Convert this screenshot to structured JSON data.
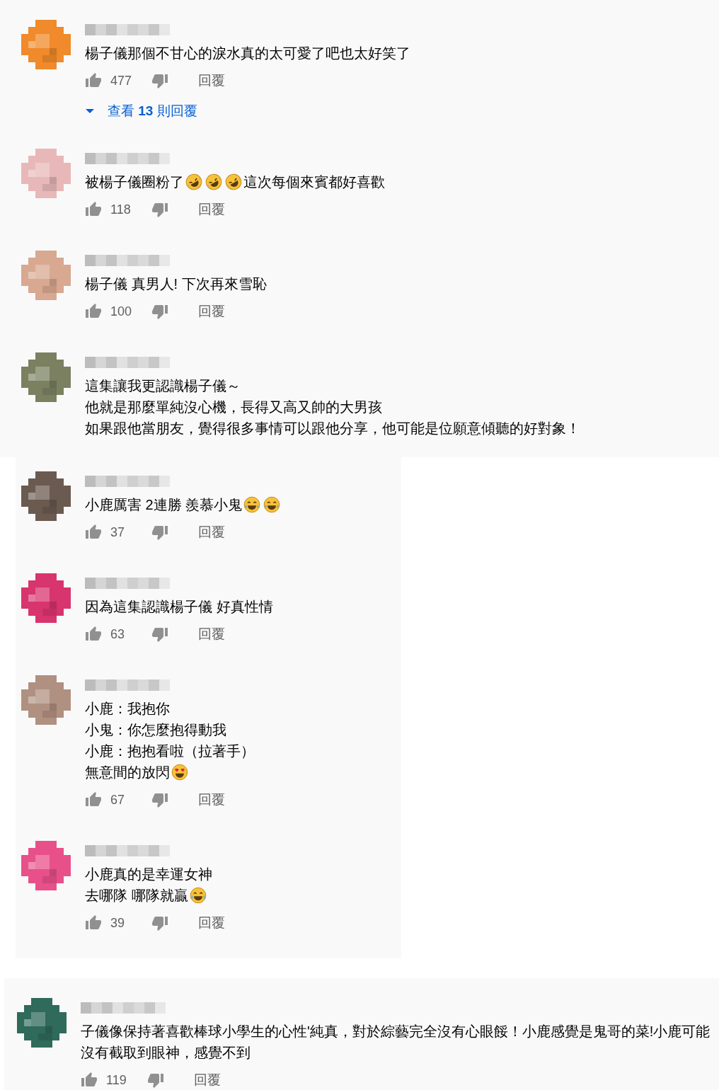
{
  "panels": [
    {
      "comments": [
        {
          "color": "#f08a2a",
          "lines": [
            [
              {
                "kind": "text",
                "text": "楊子儀那個不甘心的淚水真的太可愛了吧也太好笑了"
              }
            ]
          ],
          "likes": "477",
          "reply": "回覆",
          "view_replies": "查看 **13** 則回覆"
        },
        {
          "color": "#e8b8b8",
          "lines": [
            [
              {
                "kind": "text",
                "text": "被楊子儀圈粉了"
              },
              {
                "kind": "rolling-laugh"
              },
              {
                "kind": "rolling-laugh"
              },
              {
                "kind": "rolling-laugh"
              },
              {
                "kind": "text",
                "text": "這次每個來賓都好喜歡"
              }
            ]
          ],
          "likes": "118",
          "reply": "回覆"
        },
        {
          "color": "#d8a890",
          "lines": [
            [
              {
                "kind": "text",
                "text": "楊子儀 真男人! 下次再來雪恥"
              }
            ]
          ],
          "likes": "100",
          "reply": "回覆"
        },
        {
          "color": "#7a8060",
          "lines": [
            [
              {
                "kind": "text",
                "text": "這集讓我更認識楊子儀～"
              }
            ],
            [
              {
                "kind": "text",
                "text": "他就是那麼單純沒心機，長得又高又帥的大男孩"
              }
            ],
            [
              {
                "kind": "text",
                "text": "如果跟他當朋友，覺得很多事情可以跟他分享，他可能是位願意傾聽的好對象！"
              }
            ]
          ]
        }
      ]
    },
    {
      "comments": [
        {
          "color": "#6a5a50",
          "lines": [
            [
              {
                "kind": "text",
                "text": "小鹿厲害 2連勝 羨慕小鬼"
              },
              {
                "kind": "tears-of-joy"
              },
              {
                "kind": "tears-of-joy"
              }
            ]
          ],
          "likes": "37",
          "reply": "回覆"
        },
        {
          "color": "#d8346e",
          "lines": [
            [
              {
                "kind": "text",
                "text": "因為這集認識楊子儀 好真性情"
              }
            ]
          ],
          "likes": "63",
          "reply": "回覆"
        },
        {
          "color": "#b09080",
          "lines": [
            [
              {
                "kind": "text",
                "text": "小鹿：我抱你"
              }
            ],
            [
              {
                "kind": "text",
                "text": "小鬼：你怎麼抱得動我"
              }
            ],
            [
              {
                "kind": "text",
                "text": "小鹿：抱抱看啦（拉著手）"
              }
            ],
            [
              {
                "kind": "text",
                "text": "無意間的放閃"
              },
              {
                "kind": "heart-eyes"
              }
            ]
          ],
          "likes": "67",
          "reply": "回覆"
        },
        {
          "color": "#e8508a",
          "lines": [
            [
              {
                "kind": "text",
                "text": "小鹿真的是幸運女神"
              }
            ],
            [
              {
                "kind": "text",
                "text": "去哪隊 哪隊就贏"
              },
              {
                "kind": "tears-of-joy"
              }
            ]
          ],
          "likes": "39",
          "reply": "回覆"
        }
      ]
    },
    {
      "comments": [
        {
          "color": "#2f6a5a",
          "lines": [
            [
              {
                "kind": "text",
                "text": "子儀像保持著喜歡棒球小學生的心性'純真，對於綜藝完全沒有心眼餒！小鹿感覺是鬼哥的菜!小鹿可能沒有截取到眼神，感覺不到"
              }
            ]
          ],
          "likes": "119",
          "reply": "回覆"
        }
      ]
    }
  ]
}
